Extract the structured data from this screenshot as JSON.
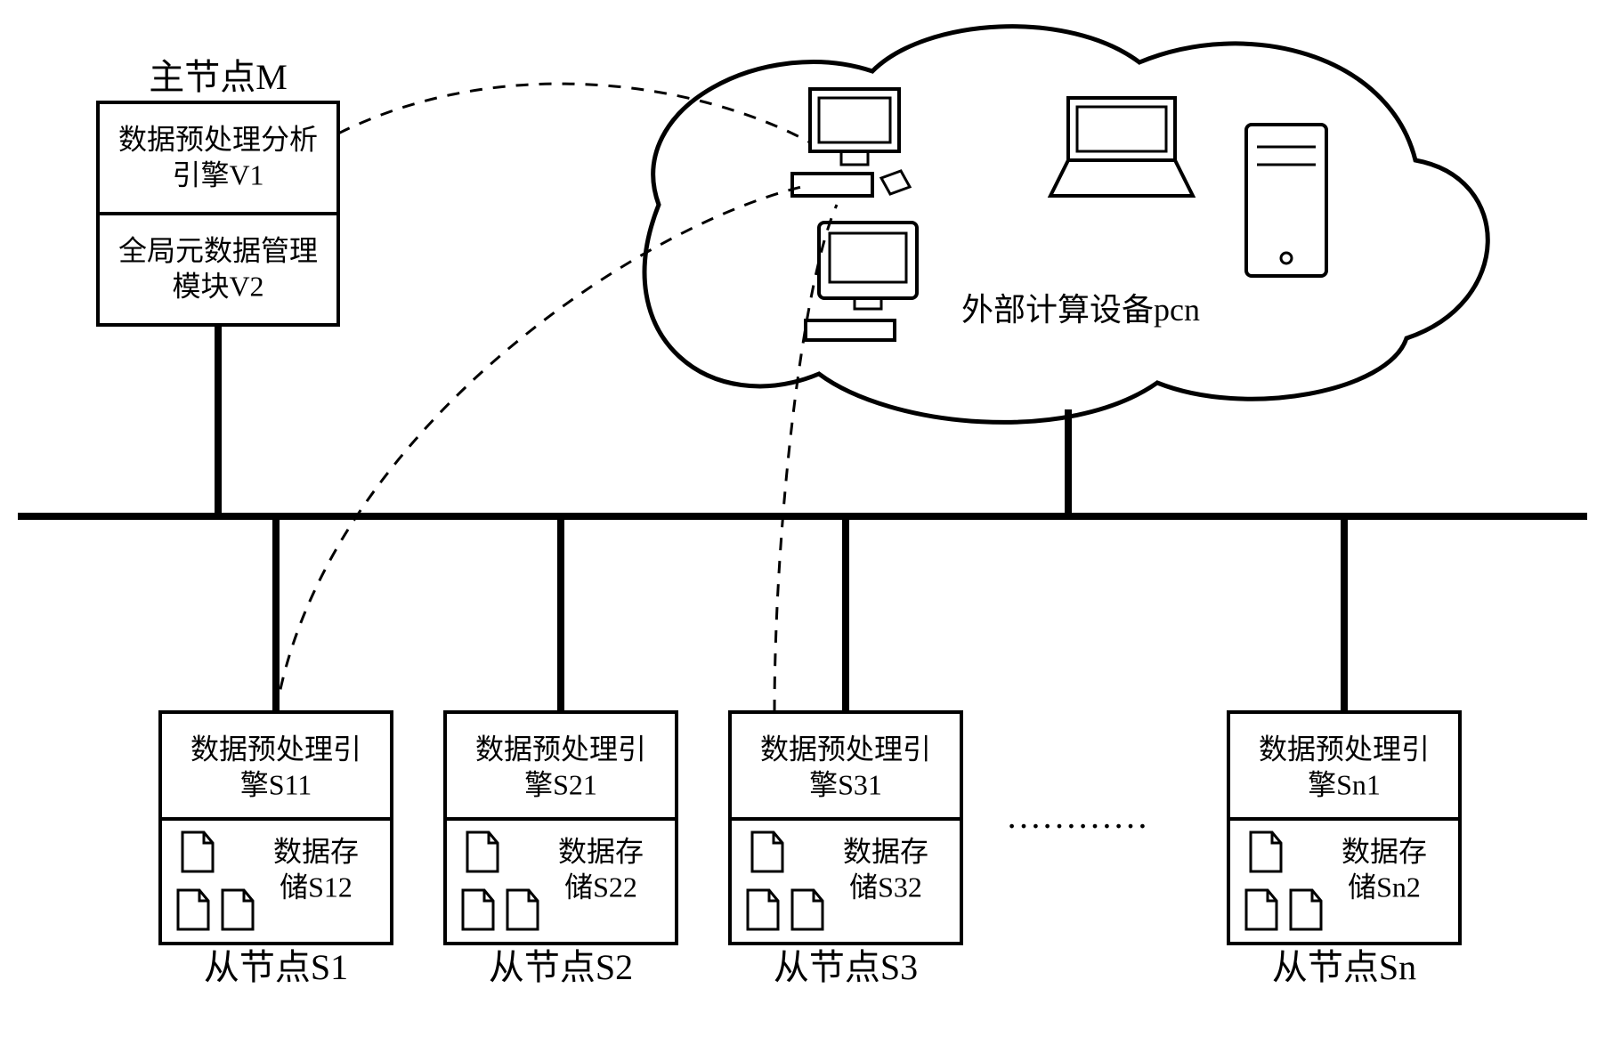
{
  "master": {
    "title": "主节点M",
    "engine_line1": "数据预处理分析",
    "engine_line2": "引擎V1",
    "meta_line1": "全局元数据管理",
    "meta_line2": "模块V2"
  },
  "cloud": {
    "label": "外部计算设备pcn"
  },
  "slaves": [
    {
      "title": "从节点S1",
      "engine_line1": "数据预处理引",
      "engine_line2": "擎S11",
      "storage_line1": "数据存",
      "storage_line2": "储S12"
    },
    {
      "title": "从节点S2",
      "engine_line1": "数据预处理引",
      "engine_line2": "擎S21",
      "storage_line1": "数据存",
      "storage_line2": "储S22"
    },
    {
      "title": "从节点S3",
      "engine_line1": "数据预处理引",
      "engine_line2": "擎S31",
      "storage_line1": "数据存",
      "storage_line2": "储S32"
    },
    {
      "title": "从节点Sn",
      "engine_line1": "数据预处理引",
      "engine_line2": "擎Sn1",
      "storage_line1": "数据存",
      "storage_line2": "储Sn2"
    }
  ],
  "ellipsis": "…………"
}
